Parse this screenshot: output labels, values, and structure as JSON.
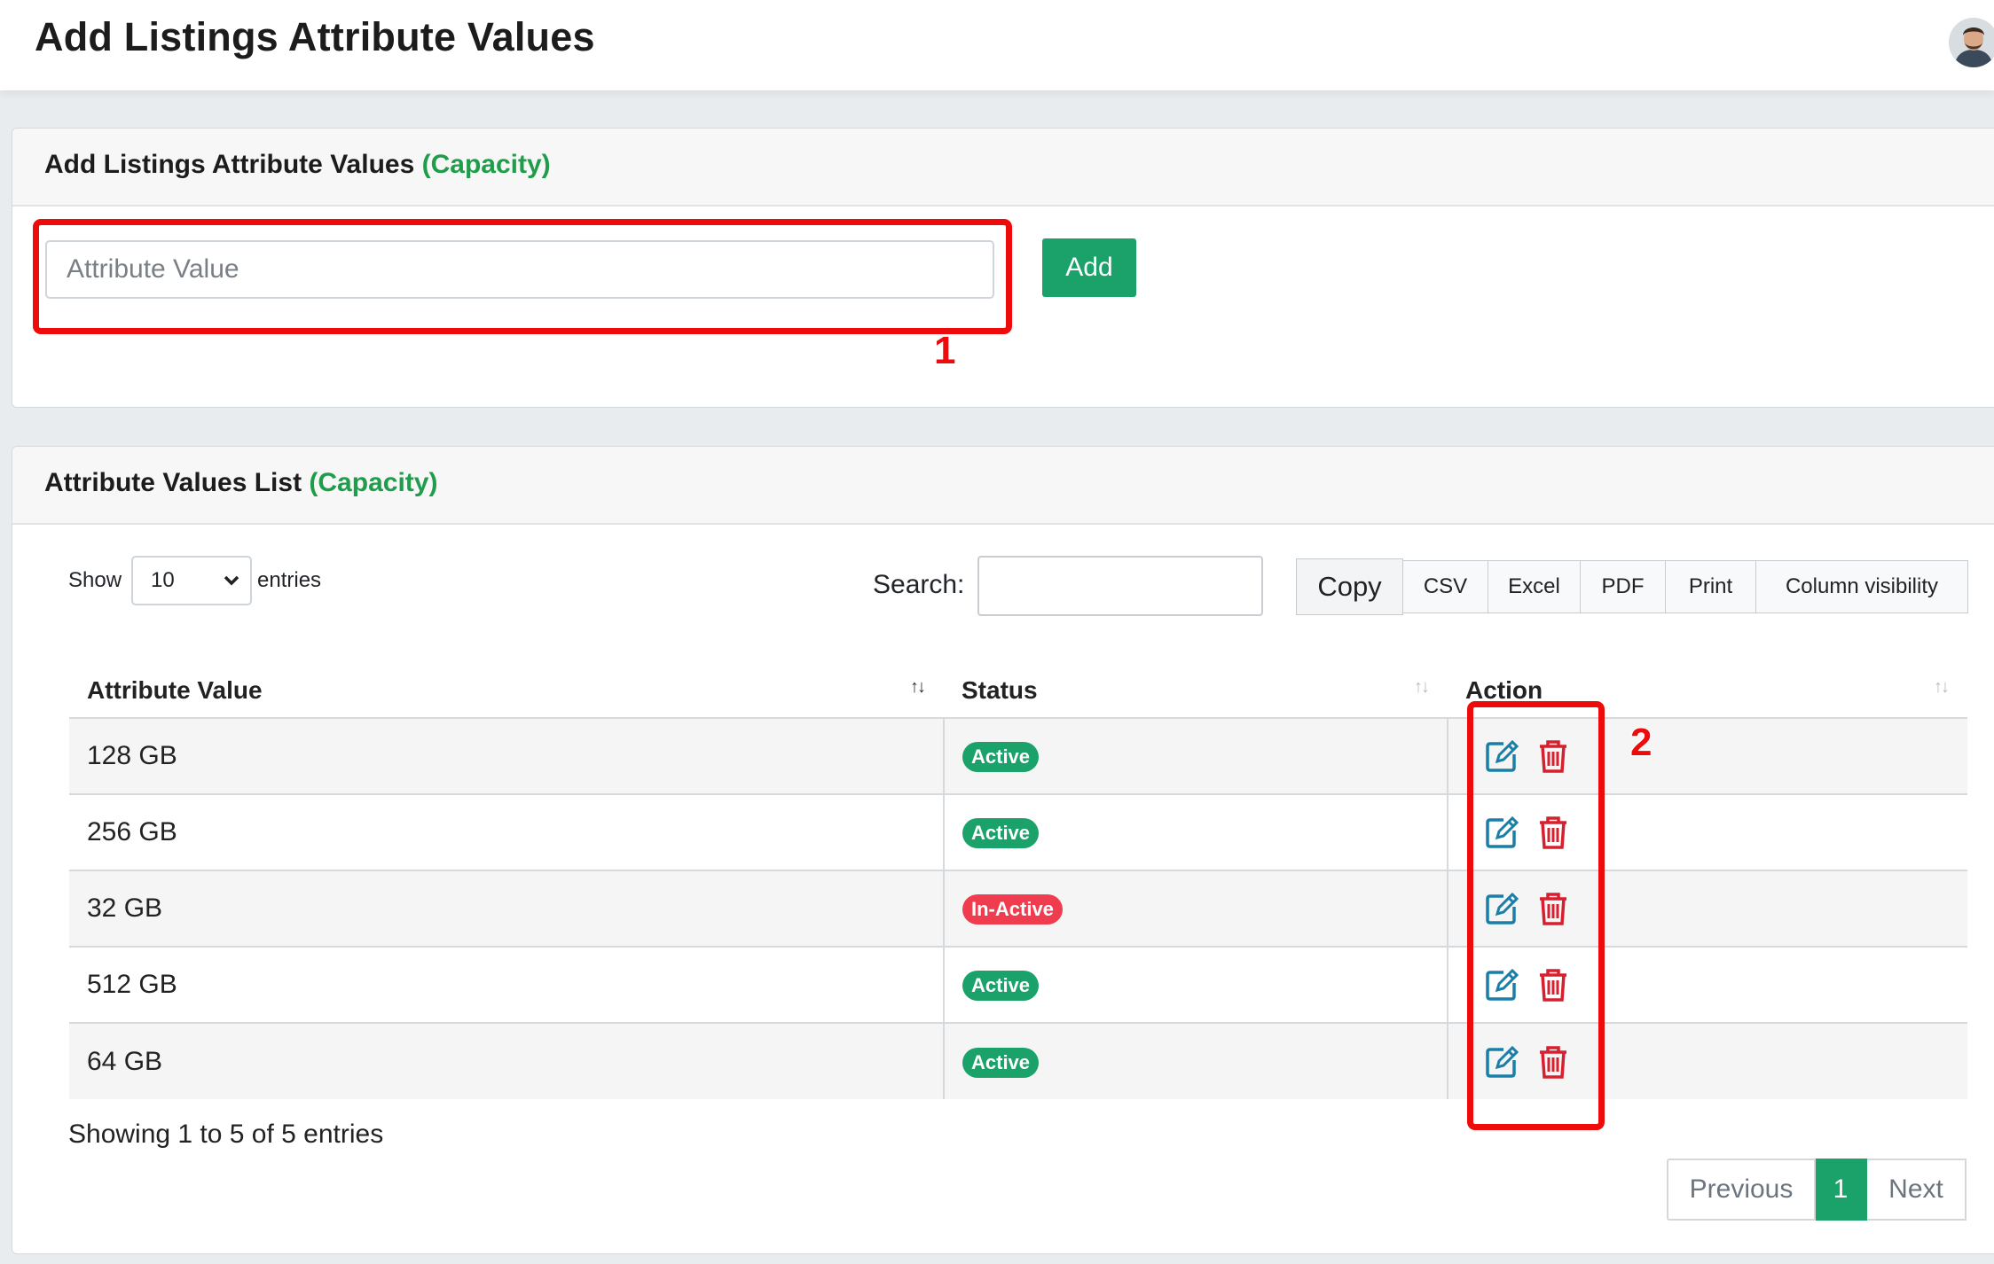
{
  "page": {
    "title": "Add Listings Attribute Values"
  },
  "add_card": {
    "title": "Add Listings Attribute Values",
    "title_accent": "(Capacity)",
    "input_placeholder": "Attribute Value",
    "add_label": "Add"
  },
  "list_card": {
    "title": "Attribute Values List",
    "title_accent": "(Capacity)"
  },
  "table_controls": {
    "show_label": "Show",
    "entries_label": "entries",
    "page_length": "10",
    "search_label": "Search:",
    "buttons": [
      "Copy",
      "CSV",
      "Excel",
      "PDF",
      "Print",
      "Column visibility"
    ]
  },
  "table": {
    "columns": [
      "Attribute Value",
      "Status",
      "Action"
    ],
    "rows": [
      {
        "value": "128 GB",
        "status": "Active"
      },
      {
        "value": "256 GB",
        "status": "Active"
      },
      {
        "value": "32 GB",
        "status": "In-Active"
      },
      {
        "value": "512 GB",
        "status": "Active"
      },
      {
        "value": "64 GB",
        "status": "Active"
      }
    ]
  },
  "footer": {
    "info": "Showing 1 to 5 of 5 entries",
    "previous": "Previous",
    "current_page": "1",
    "next": "Next"
  },
  "annotations": {
    "first": "1",
    "second": "2"
  },
  "colors": {
    "accent_green": "#1f9d4a",
    "button_green": "#1aa26a",
    "inactive_red": "#ef3d4f",
    "annotation_red": "#ee0b0b",
    "edit_icon": "#1a7fa8",
    "delete_icon": "#d6202f"
  },
  "icons": [
    "avatar",
    "edit-icon",
    "trash-icon",
    "chevron-down-icon",
    "sort-icon"
  ]
}
